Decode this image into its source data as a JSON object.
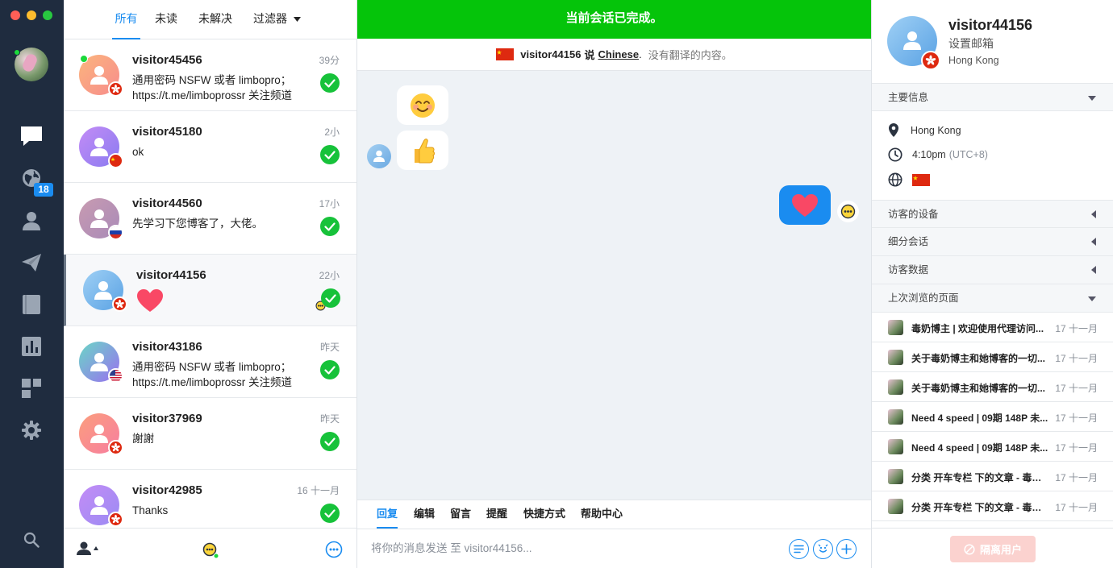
{
  "sidebar": {
    "badge_count": "18"
  },
  "filters": {
    "all": "所有",
    "unread": "未读",
    "unresolved": "未解决",
    "filter": "过滤器"
  },
  "conversations": [
    {
      "name": "visitor45456",
      "time": "39分",
      "line1": "通用密码 NSFW 或者 limbopro；",
      "line2": "https://t.me/limboprossr 关注频道",
      "flag": "hk",
      "online": true
    },
    {
      "name": "visitor45180",
      "time": "2小",
      "line1": "ok",
      "line2": "",
      "flag": "cn",
      "online": false
    },
    {
      "name": "visitor44560",
      "time": "17小",
      "line1": "先学习下您博客了，大佬。",
      "line2": "",
      "flag": "ru",
      "online": false
    },
    {
      "name": "visitor44156",
      "time": "22小",
      "line1": "",
      "line2": "",
      "flag": "hk",
      "online": false,
      "heart": true
    },
    {
      "name": "visitor43186",
      "time": "昨天",
      "line1": "通用密码 NSFW 或者 limbopro；",
      "line2": "https://t.me/limboprossr 关注频道",
      "flag": "us",
      "online": false
    },
    {
      "name": "visitor37969",
      "time": "昨天",
      "line1": "謝謝",
      "line2": "",
      "flag": "hk",
      "online": false
    },
    {
      "name": "visitor42985",
      "time": "16 十一月",
      "line1": "Thanks",
      "line2": "",
      "flag": "hk",
      "online": false
    }
  ],
  "chat": {
    "banner": "当前会话已完成。",
    "visitor": "visitor44156",
    "says": "说",
    "language": "Chinese",
    "period": ".",
    "no_translation": "没有翻译的内容。"
  },
  "composer": {
    "tabs": [
      "回复",
      "编辑",
      "留言",
      "提醒",
      "快捷方式",
      "帮助中心"
    ],
    "placeholder": "将你的消息发送 至 visitor44156..."
  },
  "visitor_panel": {
    "name": "visitor44156",
    "set_email": "设置邮箱",
    "location": "Hong Kong",
    "main_info": "主要信息",
    "city": "Hong Kong",
    "local_time": "4:10pm",
    "timezone": "(UTC+8)",
    "devices": "访客的设备",
    "segment": "细分会话",
    "visitor_data": "访客数据",
    "last_pages": "上次浏览的页面",
    "pages": [
      {
        "title": "毒奶博主 | 欢迎使用代理访问...",
        "date": "17 十一月"
      },
      {
        "title": "关于毒奶博主和她博客的一切...",
        "date": "17 十一月"
      },
      {
        "title": "关于毒奶博主和她博客的一切...",
        "date": "17 十一月"
      },
      {
        "title": "Need 4 speed | 09期 148P 未...",
        "date": "17 十一月"
      },
      {
        "title": "Need 4 speed | 09期 148P 未...",
        "date": "17 十一月"
      },
      {
        "title": "分类 开车专栏 下的文章 - 毒奶...",
        "date": "17 十一月"
      },
      {
        "title": "分类 开车专栏 下的文章 - 毒奶...",
        "date": "17 十一月"
      }
    ],
    "ban_button": "隔离用户"
  },
  "colors": {
    "accent": "#1a8cf0",
    "success": "#17c23a",
    "banner": "#05c40a",
    "sidebar": "#1f2c3f"
  }
}
